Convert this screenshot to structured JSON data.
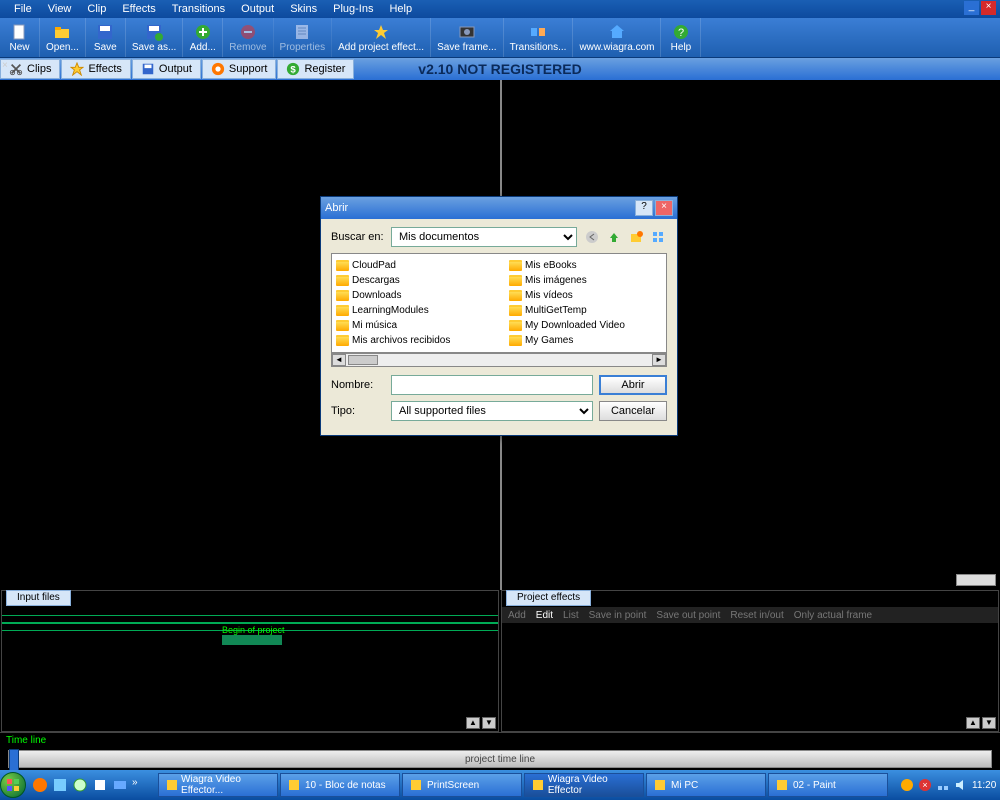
{
  "menubar": [
    "File",
    "View",
    "Clip",
    "Effects",
    "Transitions",
    "Output",
    "Skins",
    "Plug-Ins",
    "Help"
  ],
  "toolbar": [
    {
      "label": "New",
      "icon": "new"
    },
    {
      "label": "Open...",
      "icon": "open"
    },
    {
      "label": "Save",
      "icon": "save"
    },
    {
      "label": "Save as...",
      "icon": "saveas"
    },
    {
      "label": "Add...",
      "icon": "add"
    },
    {
      "label": "Remove",
      "icon": "remove",
      "disabled": true
    },
    {
      "label": "Properties",
      "icon": "props",
      "disabled": true
    },
    {
      "label": "Add project effect...",
      "icon": "fx",
      "wide": true
    },
    {
      "label": "Save frame...",
      "icon": "frame"
    },
    {
      "label": "Transitions...",
      "icon": "trans"
    },
    {
      "label": "www.wiagra.com",
      "icon": "home",
      "wide": true
    },
    {
      "label": "Help",
      "icon": "help"
    }
  ],
  "tabs": [
    {
      "label": "Clips",
      "icon": "scissors"
    },
    {
      "label": "Effects",
      "icon": "star"
    },
    {
      "label": "Output",
      "icon": "disk"
    },
    {
      "label": "Support",
      "icon": "life"
    },
    {
      "label": "Register",
      "icon": "dollar"
    }
  ],
  "version": "v2.10 NOT REGISTERED",
  "panel_left": {
    "tab": "Input files",
    "begin": "Begin of project"
  },
  "panel_right": {
    "tab": "Project effects",
    "actions": [
      "Add",
      "Edit",
      "List",
      "Save in point",
      "Save out point",
      "Reset in/out",
      "Only actual frame"
    ],
    "active": 1
  },
  "timeline": {
    "label": "Time line",
    "bar": "project time line"
  },
  "dialog": {
    "title": "Abrir",
    "lookin_label": "Buscar en:",
    "lookin_value": "Mis documentos",
    "files": [
      "CloudPad",
      "Descargas",
      "Downloads",
      "LearningModules",
      "Mi música",
      "Mis archivos recibidos",
      "Mis eBooks",
      "Mis imágenes",
      "Mis vídeos",
      "MultiGetTemp",
      "My Downloaded Video",
      "My Games"
    ],
    "name_label": "Nombre:",
    "name_value": "",
    "type_label": "Tipo:",
    "type_value": "All supported files",
    "open_btn": "Abrir",
    "cancel_btn": "Cancelar"
  },
  "taskbar": {
    "tasks": [
      {
        "label": "Wiagra Video Effector...",
        "active": false
      },
      {
        "label": "10 - Bloc de notas",
        "active": false
      },
      {
        "label": "PrintScreen",
        "active": false
      },
      {
        "label": "Wiagra Video Effector",
        "active": true
      },
      {
        "label": "Mi PC",
        "active": false
      },
      {
        "label": "02 - Paint",
        "active": false
      }
    ],
    "clock": "11:20"
  }
}
